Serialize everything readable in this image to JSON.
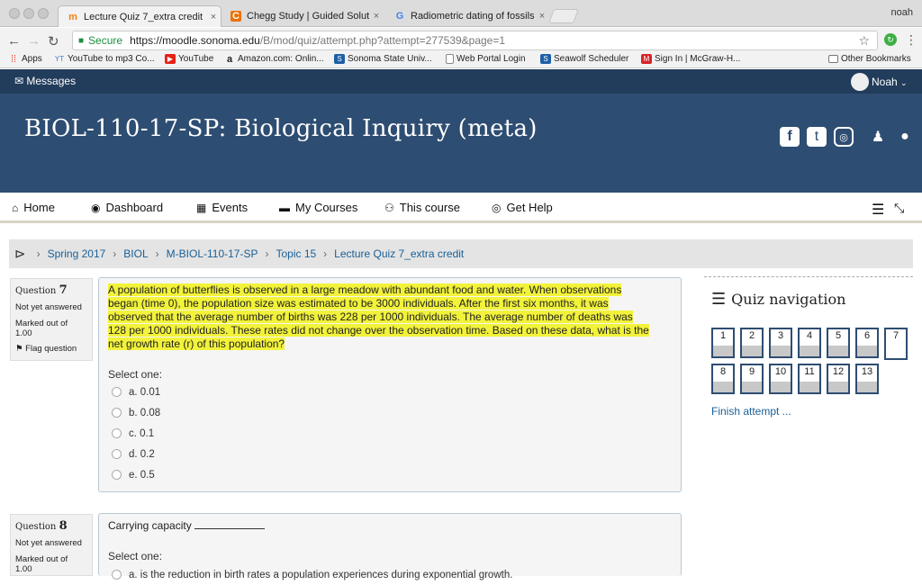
{
  "browser": {
    "tabs": [
      {
        "title": "Lecture Quiz 7_extra credit",
        "icon": "moodle-icon",
        "close": "×"
      },
      {
        "title": "Chegg Study | Guided Solution",
        "icon": "chegg-icon",
        "close": "×"
      },
      {
        "title": "Radiometric dating of fossils in",
        "icon": "google-icon",
        "close": "×"
      }
    ],
    "user": "noah",
    "secure_label": "Secure",
    "url_host": "https://moodle.sonoma.edu",
    "url_path": "/B/mod/quiz/attempt.php?attempt=277539&page=1",
    "bookmarks": [
      {
        "label": "Apps",
        "icon": "apps-icon",
        "color": "#e8453c"
      },
      {
        "label": "YouTube to mp3 Co...",
        "icon": "ytmp3-icon",
        "color": "#3a7bd5"
      },
      {
        "label": "YouTube",
        "icon": "youtube-icon",
        "color": "#e62117"
      },
      {
        "label": "Amazon.com: Onlin...",
        "icon": "amazon-icon",
        "color": "#222222"
      },
      {
        "label": "Sonoma State Univ...",
        "icon": "sonoma-icon",
        "color": "#1d5fa6"
      },
      {
        "label": "Web Portal Login",
        "icon": "page-icon",
        "color": "#888888"
      },
      {
        "label": "Seawolf Scheduler",
        "icon": "sonoma-icon",
        "color": "#1d5fa6"
      },
      {
        "label": "Sign In | McGraw-H...",
        "icon": "mcgraw-icon",
        "color": "#d8232a"
      }
    ],
    "other_bookmarks": "Other Bookmarks"
  },
  "site": {
    "messages_label": "Messages",
    "account_name": "Noah",
    "course_title": "BIOL-110-17-SP: Biological Inquiry (meta)",
    "nav": [
      {
        "label": "Home",
        "icon": "home-icon",
        "glyph": "⌂"
      },
      {
        "label": "Dashboard",
        "icon": "dashboard-icon",
        "glyph": "◉"
      },
      {
        "label": "Events",
        "icon": "calendar-icon",
        "glyph": "▦"
      },
      {
        "label": "My Courses",
        "icon": "briefcase-icon",
        "glyph": "▬"
      },
      {
        "label": "This course",
        "icon": "sitemap-icon",
        "glyph": "⚇"
      },
      {
        "label": "Get Help",
        "icon": "lifebuoy-icon",
        "glyph": "◎"
      }
    ],
    "breadcrumb": [
      "Spring 2017",
      "BIOL",
      "M-BIOL-110-17-SP",
      "Topic 15",
      "Lecture Quiz 7_extra credit"
    ]
  },
  "questions": [
    {
      "label": "Question",
      "number": "7",
      "status": "Not yet answered",
      "marked": "Marked out of",
      "points": "1.00",
      "flag": "Flag question",
      "text_lines": [
        "A population of butterflies is observed in a large meadow with abundant food and water. When observations",
        "began (time 0), the population size was estimated to be 3000 individuals. After the first six months, it was",
        "observed that the average number of births was 228 per 1000 individuals. The average number of deaths was",
        "128 per 1000 individuals. These rates did not change over the observation time. Based on these data, what is the",
        "net growth rate (r) of this population?"
      ],
      "select_label": "Select one:",
      "options": [
        "a. 0.01",
        "b. 0.08",
        "c. 0.1",
        "d. 0.2",
        "e. 0.5"
      ]
    },
    {
      "label": "Question",
      "number": "8",
      "status": "Not yet answered",
      "marked": "Marked out of",
      "points": "1.00",
      "text": "Carrying capacity",
      "select_label": "Select one:",
      "options": [
        "a. is the reduction in birth rates a population experiences during exponential growth."
      ]
    }
  ],
  "quiz_nav": {
    "title": "Quiz navigation",
    "buttons": [
      "1",
      "2",
      "3",
      "4",
      "5",
      "6",
      "7",
      "8",
      "9",
      "10",
      "11",
      "12",
      "13"
    ],
    "current": "7",
    "finish": "Finish attempt ..."
  }
}
